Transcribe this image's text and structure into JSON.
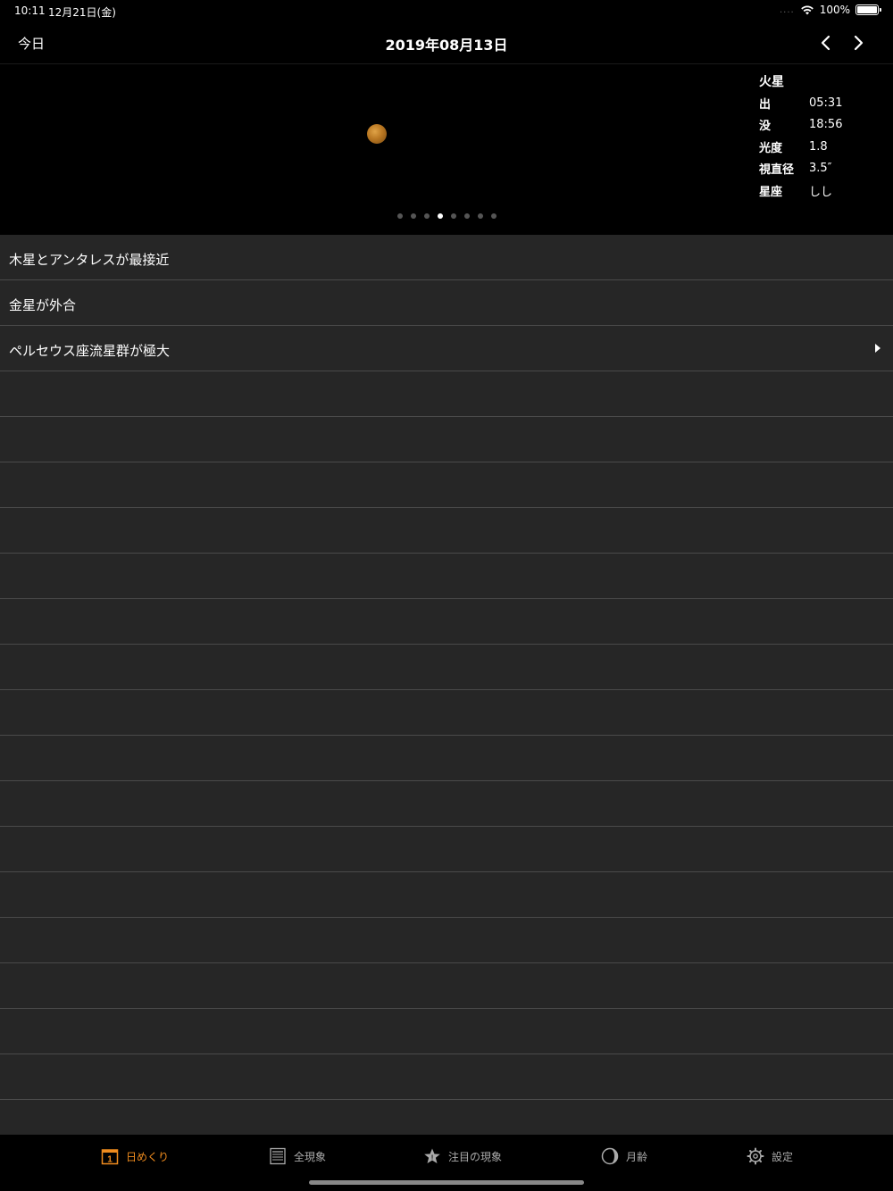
{
  "status_bar": {
    "time": "10:11",
    "date": "12月21日(金)",
    "signal": "....",
    "battery": "100%"
  },
  "nav": {
    "today_label": "今日",
    "title": "2019年08月13日"
  },
  "planet": {
    "name": "火星",
    "rows": [
      {
        "key": "出",
        "value": "05:31"
      },
      {
        "key": "没",
        "value": "18:56"
      },
      {
        "key": "光度",
        "value": "1.8"
      },
      {
        "key": "視直径",
        "value": "3.5″"
      },
      {
        "key": "星座",
        "value": "しし"
      }
    ],
    "page_count": 8,
    "page_active": 4
  },
  "events": [
    {
      "label": "木星とアンタレスが最接近",
      "has_arrow": false
    },
    {
      "label": "金星が外合",
      "has_arrow": false
    },
    {
      "label": "ペルセウス座流星群が極大",
      "has_arrow": true
    }
  ],
  "empty_rows": 17,
  "tabs": [
    {
      "label": "日めくり",
      "icon": "calendar-icon",
      "active": true
    },
    {
      "label": "全現象",
      "icon": "list-icon",
      "active": false
    },
    {
      "label": "注目の現象",
      "icon": "star-icon",
      "active": false
    },
    {
      "label": "月齢",
      "icon": "moon-icon",
      "active": false
    },
    {
      "label": "設定",
      "icon": "gear-icon",
      "active": false
    }
  ],
  "colors": {
    "accent": "#f08c1e",
    "list_bg": "#262626",
    "separator": "#4a4a4a"
  }
}
